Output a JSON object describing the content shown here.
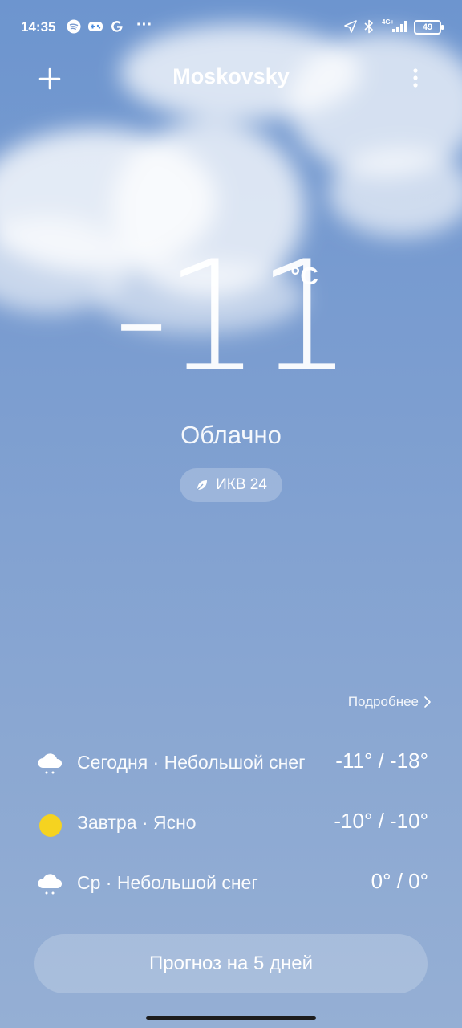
{
  "status_bar": {
    "time": "14:35",
    "network": "4G+",
    "battery": "49",
    "more": "···"
  },
  "header": {
    "city": "Moskovsky"
  },
  "current": {
    "temperature": "-11",
    "unit": "°C",
    "condition": "Облачно",
    "aqi_label": "ИКВ 24"
  },
  "details_link": "Подробнее",
  "forecast": [
    {
      "day": "Сегодня · Небольшой снег",
      "temps": "-11° / -18°",
      "icon": "snow-cloud-icon"
    },
    {
      "day": "Завтра · Ясно",
      "temps": "-10° / -10°",
      "icon": "sun-icon"
    },
    {
      "day": "Ср · Небольшой снег",
      "temps": "0° / 0°",
      "icon": "snow-cloud-icon"
    }
  ],
  "forecast_button": "Прогноз на 5 дней",
  "colors": {
    "sky_top": "#6d95cf",
    "sky_bottom": "#95afd4",
    "sun": "#f5d320"
  }
}
